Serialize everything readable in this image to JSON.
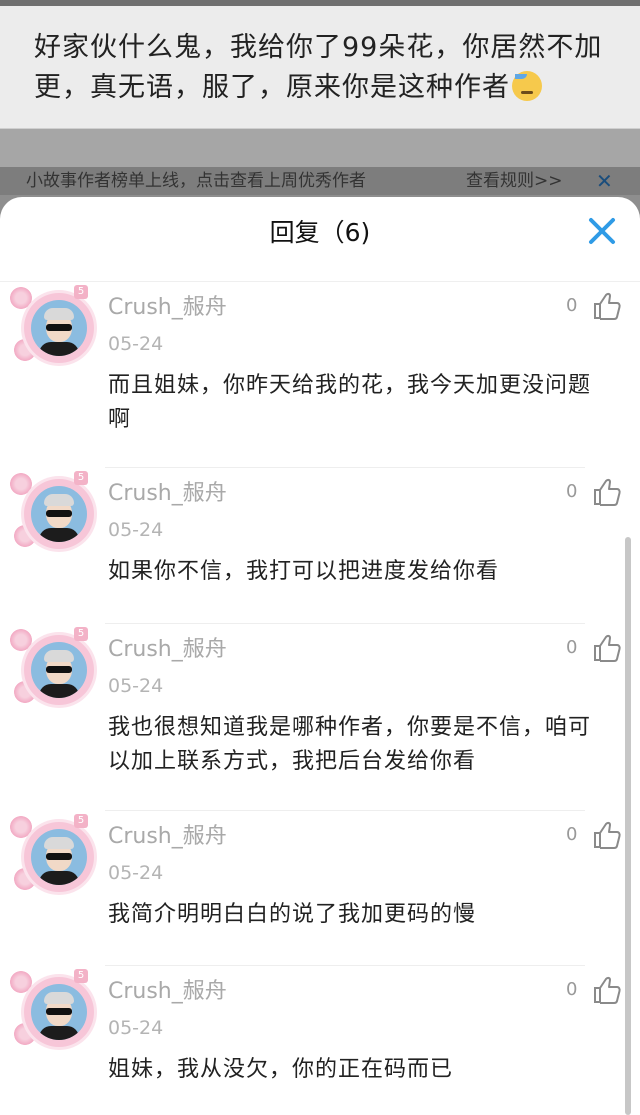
{
  "background_comment": {
    "text": "好家伙什么鬼，我给你了99朵花，你居然不加更，真无语，服了，原来你是这种作者",
    "emoji": "sweat-face-icon"
  },
  "notice": {
    "text": "小故事作者榜单上线，点击查看上周优秀作者",
    "rules_link": "查看规则>>",
    "close_icon": "close-icon"
  },
  "sheet": {
    "title": "回复（6)",
    "close_icon": "close-icon"
  },
  "replies": [
    {
      "username": "Crush_赧舟",
      "date": "05-24",
      "likes": "0",
      "content": "而且姐妹，你昨天给我的花，我今天加更没问题啊"
    },
    {
      "username": "Crush_赧舟",
      "date": "05-24",
      "likes": "0",
      "content": "如果你不信，我打可以把进度发给你看"
    },
    {
      "username": "Crush_赧舟",
      "date": "05-24",
      "likes": "0",
      "content": "我也很想知道我是哪种作者，你要是不信，咱可以加上联系方式，我把后台发给你看"
    },
    {
      "username": "Crush_赧舟",
      "date": "05-24",
      "likes": "0",
      "content": "我简介明明白白的说了我加更码的慢"
    },
    {
      "username": "Crush_赧舟",
      "date": "05-24",
      "likes": "0",
      "content": "姐妹，我从没欠，你的正在码而已"
    }
  ],
  "colors": {
    "accent": "#2f9be6",
    "avatar_ring": "#f7c6d8"
  }
}
